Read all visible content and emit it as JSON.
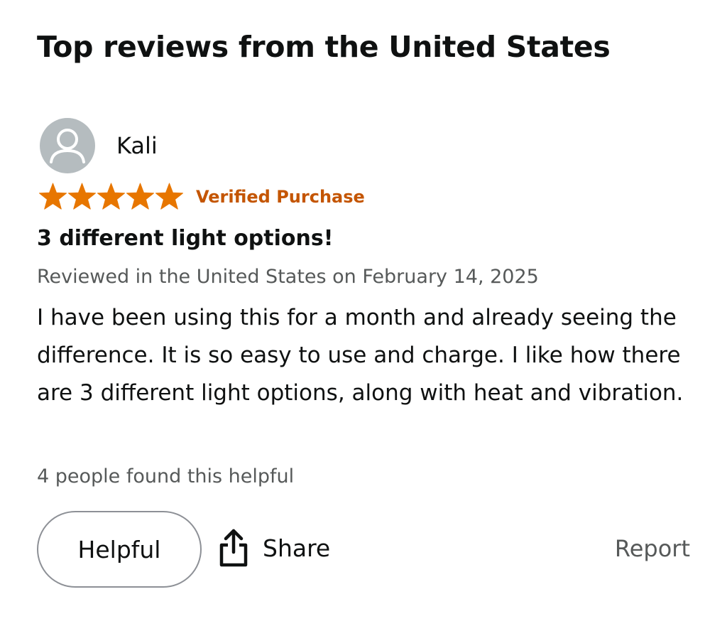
{
  "section_title": "Top reviews from the United States",
  "review": {
    "reviewer_name": "Kali",
    "avatar_icon": "person-silhouette-icon",
    "rating": 5,
    "rating_max": 5,
    "star_color": "#e77600",
    "verified_label": "Verified Purchase",
    "verified_color": "#c45500",
    "title": "3 different light options!",
    "date_line": "Reviewed in the United States on February 14, 2025",
    "body": "I have been using this for a month and already seeing the difference. It is so easy to use and charge. I like how there are 3 different light options, along with heat and vibration.",
    "helpful_count_text": "4 people found this helpful"
  },
  "actions": {
    "helpful_label": "Helpful",
    "share_label": "Share",
    "share_icon": "share-upload-icon",
    "report_label": "Report"
  }
}
